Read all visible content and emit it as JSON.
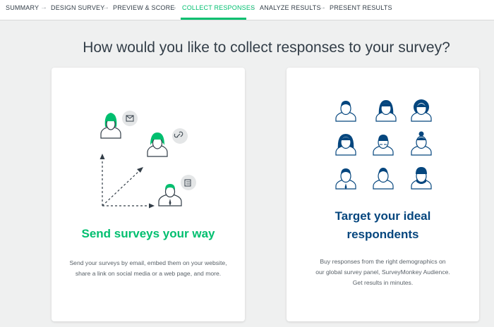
{
  "nav": {
    "steps": [
      {
        "label": "SUMMARY"
      },
      {
        "label": "DESIGN SURVEY"
      },
      {
        "label": "PREVIEW & SCORE"
      },
      {
        "label": "COLLECT RESPONSES"
      },
      {
        "label": "ANALYZE RESULTS"
      },
      {
        "label": "PRESENT RESULTS"
      }
    ],
    "active_step": "COLLECT RESPONSES",
    "separator": "→"
  },
  "headline": "How would you like to collect responses to your survey?",
  "cards": [
    {
      "title": "Send surveys your way",
      "description_lines": [
        "Send your surveys by email, embed them on your website,",
        "share a link on social media or a web page, and more."
      ],
      "icons": [
        "email-icon",
        "link-icon",
        "document-icon"
      ]
    },
    {
      "title_lines": [
        "Target your ideal",
        "respondents"
      ],
      "description_lines": [
        "Buy responses from the right demographics on",
        "our global survey panel, SurveyMonkey Audience.",
        "Get results in minutes."
      ]
    }
  ],
  "colors": {
    "accent": "#00bf6f",
    "navy": "#05467e",
    "background": "#eff0f0"
  }
}
